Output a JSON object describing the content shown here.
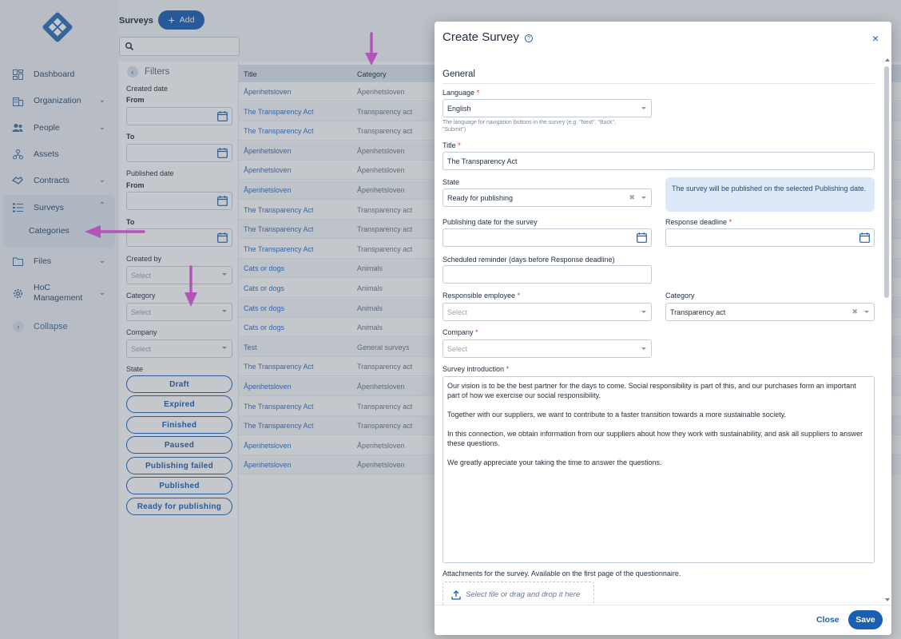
{
  "sidebar": {
    "items": [
      {
        "label": "Dashboard",
        "icon": "dashboard-icon"
      },
      {
        "label": "Organization",
        "icon": "organization-icon"
      },
      {
        "label": "People",
        "icon": "people-icon"
      },
      {
        "label": "Assets",
        "icon": "assets-icon"
      },
      {
        "label": "Contracts",
        "icon": "contracts-icon"
      },
      {
        "label": "Surveys",
        "icon": "surveys-icon"
      },
      {
        "label": "Files",
        "icon": "files-icon"
      },
      {
        "label": "HoC Management",
        "icon": "gear-icon"
      }
    ],
    "sub_item": "Categories",
    "collapse_label": "Collapse"
  },
  "header": {
    "title": "Surveys",
    "add_label": "Add"
  },
  "filters": {
    "title": "Filters",
    "created_date": "Created date",
    "from": "From",
    "to": "To",
    "published_date": "Published date",
    "created_by": "Created by",
    "category": "Category",
    "company": "Company",
    "select_placeholder": "Select",
    "state": "State",
    "states": [
      "Draft",
      "Expired",
      "Finished",
      "Paused",
      "Publishing failed",
      "Published",
      "Ready for publishing"
    ]
  },
  "table": {
    "columns": [
      "Title",
      "Category"
    ],
    "rows": [
      [
        "Åpenhetsloven",
        "Åpenhetsloven"
      ],
      [
        "The Transparency Act",
        "Transparency act"
      ],
      [
        "The Transparency Act",
        "Transparency act"
      ],
      [
        "Åpenhetsloven",
        "Åpenhetsloven"
      ],
      [
        "Åpenhetsloven",
        "Åpenhetsloven"
      ],
      [
        "Åpenhetsloven",
        "Åpenhetsloven"
      ],
      [
        "The Transparency Act",
        "Transparency act"
      ],
      [
        "The Transparency Act",
        "Transparency act"
      ],
      [
        "The Transparency Act",
        "Transparency act"
      ],
      [
        "Cats or dogs",
        "Animals"
      ],
      [
        "Cats or dogs",
        "Animals"
      ],
      [
        "Cats or dogs",
        "Animals"
      ],
      [
        "Cats or dogs",
        "Animals"
      ],
      [
        "Test",
        "General surveys"
      ],
      [
        "The Transparency Act",
        "Transparency act"
      ],
      [
        "Åpenhetsloven",
        "Åpenhetsloven"
      ],
      [
        "The Transparency Act",
        "Transparency act"
      ],
      [
        "The Transparency Act",
        "Transparency act"
      ],
      [
        "Åpenhetsloven",
        "Åpenhetsloven"
      ],
      [
        "Åpenhetsloven",
        "Åpenhetsloven"
      ]
    ]
  },
  "modal": {
    "title": "Create Survey",
    "help": "?",
    "close": "×",
    "section": "General",
    "language_label": "Language",
    "language_value": "English",
    "language_hint": "The language for navigation buttons in the survey (e.g. \"Next\", \"Back\", \"Submit\")",
    "title_label": "Title",
    "title_value": "The Transparency Act",
    "state_label": "State",
    "state_value": "Ready for publishing",
    "info_text": "The survey will be published on the selected Publishing date.",
    "publishing_date_label": "Publishing date for the survey",
    "response_deadline_label": "Response deadline",
    "reminder_label": "Scheduled reminder (days before Response deadline)",
    "responsible_label": "Responsible employee",
    "responsible_placeholder": "Select",
    "category_label": "Category",
    "category_value": "Transparency act",
    "company_label": "Company",
    "company_placeholder": "Select",
    "intro_label": "Survey introduction",
    "intro_paragraphs": [
      "Our vision is to be the best partner for the days to come. Social responsibility is part of this, and our purchases form an important part of how we exercise our social responsibility.",
      "Together with our suppliers, we want to contribute to a faster transition towards a more sustainable society.",
      "In this connection, we obtain information from our suppliers about how they work with sustainability, and ask all suppliers to answer these questions.",
      "We greatly appreciate your taking the time to answer the questions."
    ],
    "attachments_label": "Attachments for the survey. Available on the first page of the questionnaire.",
    "dropzone_text": "Select file or drag and drop it here",
    "close_label": "Close",
    "save_label": "Save"
  },
  "colors": {
    "accent": "#1b5fb3",
    "arrow": "#b355b8"
  }
}
